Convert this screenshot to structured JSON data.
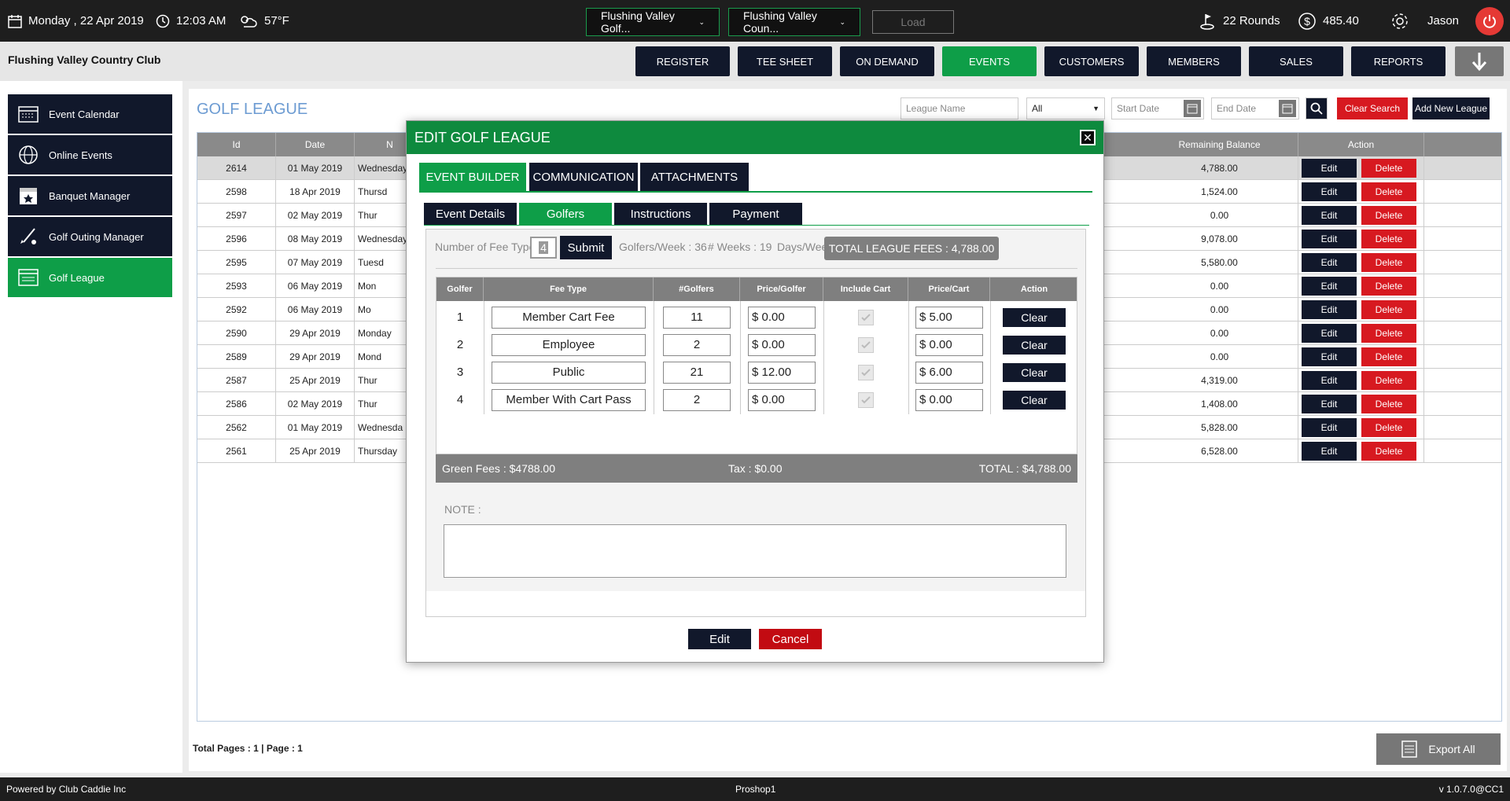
{
  "topbar": {
    "date": "Monday ,  22 Apr 2019",
    "time": "12:03 AM",
    "weather": "57°F",
    "course_select": "Flushing Valley Golf...",
    "club_select": "Flushing Valley Coun...",
    "load": "Load",
    "rounds": "22 Rounds",
    "balance": "485.40",
    "user": "Jason"
  },
  "club_name": "Flushing Valley Country Club",
  "nav": [
    "REGISTER",
    "TEE SHEET",
    "ON DEMAND",
    "EVENTS",
    "CUSTOMERS",
    "MEMBERS",
    "SALES",
    "REPORTS"
  ],
  "sidebar": [
    {
      "label": "Event Calendar",
      "icon": "calendar-icon"
    },
    {
      "label": "Online Events",
      "icon": "globe-icon"
    },
    {
      "label": "Banquet Manager",
      "icon": "star-calendar-icon"
    },
    {
      "label": "Golf Outing Manager",
      "icon": "golf-club-icon"
    },
    {
      "label": "Golf League",
      "icon": "list-calendar-icon"
    }
  ],
  "page": {
    "title": "GOLF LEAGUE",
    "league_name_placeholder": "League Name",
    "status_select": "All",
    "start_date_placeholder": "Start Date",
    "end_date_placeholder": "End Date",
    "clear_search": "Clear Search",
    "add_new": "Add New League",
    "pages_label": "Total Pages : 1 | Page : 1",
    "export": "Export All"
  },
  "table": {
    "headers": {
      "id": "Id",
      "date": "Date",
      "name": "N",
      "balance": "Remaining Balance",
      "action": "Action"
    },
    "edit_label": "Edit",
    "delete_label": "Delete",
    "rows": [
      {
        "id": "2614",
        "date": "01 May 2019",
        "day": "Wednesday",
        "balance": "4,788.00"
      },
      {
        "id": "2598",
        "date": "18 Apr 2019",
        "day": "Thursd",
        "balance": "1,524.00"
      },
      {
        "id": "2597",
        "date": "02 May 2019",
        "day": "Thur",
        "balance": "0.00"
      },
      {
        "id": "2596",
        "date": "08 May 2019",
        "day": "Wednesday",
        "balance": "9,078.00"
      },
      {
        "id": "2595",
        "date": "07 May 2019",
        "day": "Tuesd",
        "balance": "5,580.00"
      },
      {
        "id": "2593",
        "date": "06 May 2019",
        "day": "Mon",
        "balance": "0.00"
      },
      {
        "id": "2592",
        "date": "06 May 2019",
        "day": "Mo",
        "balance": "0.00"
      },
      {
        "id": "2590",
        "date": "29 Apr 2019",
        "day": "Monday",
        "balance": "0.00"
      },
      {
        "id": "2589",
        "date": "29 Apr 2019",
        "day": "Mond",
        "balance": "0.00"
      },
      {
        "id": "2587",
        "date": "25 Apr 2019",
        "day": "Thur",
        "balance": "4,319.00"
      },
      {
        "id": "2586",
        "date": "02 May 2019",
        "day": "Thur",
        "balance": "1,408.00"
      },
      {
        "id": "2562",
        "date": "01 May 2019",
        "day": "Wednesda",
        "balance": "5,828.00"
      },
      {
        "id": "2561",
        "date": "25 Apr 2019",
        "day": "Thursday",
        "balance": "6,528.00"
      }
    ]
  },
  "modal": {
    "title": "EDIT GOLF LEAGUE",
    "tabs": [
      "EVENT BUILDER",
      "COMMUNICATION",
      "ATTACHMENTS"
    ],
    "subtabs": [
      "Event Details",
      "Golfers",
      "Instructions",
      "Payment"
    ],
    "fee_types_label": "Number of Fee Types",
    "fee_types_value": "4",
    "submit": "Submit",
    "golfers_week": "Golfers/Week : 36",
    "weeks": "# Weeks : 19",
    "days_week": "Days/Week",
    "total_fees": "TOTAL LEAGUE FEES : 4,788.00",
    "fee_headers": [
      "Golfer",
      "Fee Type",
      "#Golfers",
      "Price/Golfer",
      "Include Cart",
      "Price/Cart",
      "Action"
    ],
    "fees": [
      {
        "n": "1",
        "type": "Member Cart Fee",
        "golfers": "11",
        "price": "$ 0.00",
        "cart": "$ 5.00"
      },
      {
        "n": "2",
        "type": "Employee",
        "golfers": "2",
        "price": "$ 0.00",
        "cart": "$ 0.00"
      },
      {
        "n": "3",
        "type": "Public",
        "golfers": "21",
        "price": "$ 12.00",
        "cart": "$ 6.00"
      },
      {
        "n": "4",
        "type": "Member With Cart Pass",
        "golfers": "2",
        "price": "$ 0.00",
        "cart": "$ 0.00"
      }
    ],
    "clear_label": "Clear",
    "green_fees": "Green Fees : $4788.00",
    "tax": "Tax : $0.00",
    "total": "TOTAL : $4,788.00",
    "note_label": "NOTE :",
    "edit": "Edit",
    "cancel": "Cancel"
  },
  "footer": {
    "left": "Powered by Club Caddie Inc",
    "center": "Proshop1",
    "right": "v 1.0.7.0@CC1"
  },
  "colors": {
    "green": "#0e9e48",
    "navy": "#11182b",
    "red": "#d71920",
    "title_blue": "#6c9bd2"
  }
}
